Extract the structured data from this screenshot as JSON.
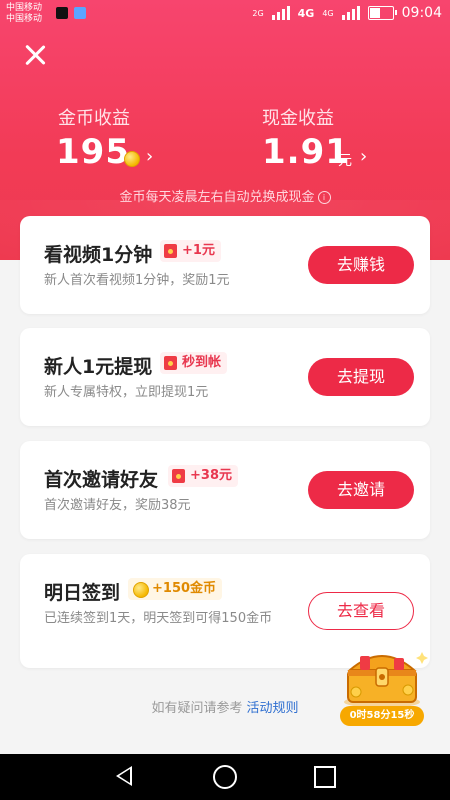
{
  "status_bar": {
    "carrier_1": "中国移动",
    "carrier_2": "中国移动",
    "network_1": "2G",
    "network_2": "4G",
    "network_3": "4G",
    "time": "09:04"
  },
  "header": {
    "coins_label": "金币收益",
    "coins_value": "195",
    "cash_label": "现金收益",
    "cash_value": "1.91",
    "cash_unit": "元",
    "chevron": "›",
    "note": "金币每天凌晨左右自动兑换成现金",
    "info_icon": "ⓘ"
  },
  "tasks": [
    {
      "title": "看视频1分钟",
      "tag": "+1元",
      "subtitle": "新人首次看视频1分钟，奖励1元",
      "button": "去赚钱"
    },
    {
      "title": "新人1元提现",
      "tag": "秒到帐",
      "subtitle": "新人专属特权，立即提现1元",
      "button": "去提现"
    },
    {
      "title": "首次邀请好友",
      "tag": "+38元",
      "subtitle": "首次邀请好友，奖励38元",
      "button": "去邀请"
    },
    {
      "title": "明日签到",
      "tag": "+150金币",
      "subtitle": "已连续签到1天，明天签到可得150金币",
      "button": "去查看"
    }
  ],
  "footer": {
    "text": "如有疑问请参考",
    "link": "活动规则"
  },
  "chest": {
    "timer": "0时58分15秒"
  },
  "colors": {
    "header_top": "#f7456e",
    "accent": "#ed2a47",
    "tag_bg": "#fff0f1",
    "link": "#2f6fd0"
  }
}
